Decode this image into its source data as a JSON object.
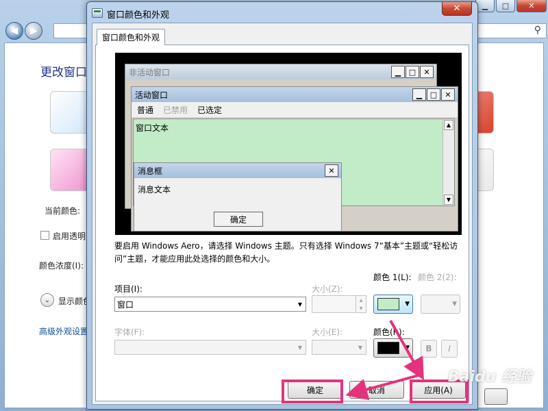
{
  "background": {
    "heading": "更改窗口",
    "current_color_label": "当前颜色:",
    "enable_transparency_label": "启用透明",
    "color_intensity_label": "颜色浓度(I):",
    "show_color_mixer_label": "显示颜色",
    "advanced_link": "高级外观设置",
    "swatch_colors": [
      "#d9ecfa",
      "#f3a9d8",
      "#d9412e",
      "#efefef"
    ]
  },
  "dialog": {
    "title": "窗口颜色和外观",
    "close_glyph": "✕",
    "tab_label": "窗口颜色和外观",
    "preview": {
      "inactive_title": "非活动窗口",
      "active_title": "活动窗口",
      "menu_normal": "普通",
      "menu_disabled": "已禁用",
      "menu_selected": "已选定",
      "window_text": "窗口文本",
      "msgbox_title": "消息框",
      "msgbox_text": "消息文本",
      "ok_label": "确定",
      "window_text_bg": "#c2ebc8"
    },
    "info_text": "要启用 Windows Aero，请选择 Windows 主题。只有选择 Windows 7“基本”主题或“轻松访问”主题，才能应用此处选择的颜色和大小。",
    "item_label": "项目(I):",
    "item_value": "窗口",
    "size_label": "大小(Z):",
    "color1_label": "颜色 1(L):",
    "color2_label": "颜色 2(2):",
    "color1_value": "#c2ebc8",
    "font_label": "字体(F):",
    "font_size_label": "大小(E):",
    "font_color_label": "颜色(R):",
    "font_color_value": "#000000",
    "bold_label": "B",
    "italic_label": "I",
    "ok_button": "确定",
    "cancel_button": "取消",
    "apply_button": "应用(A)"
  },
  "watermark": "Baidu 经验"
}
